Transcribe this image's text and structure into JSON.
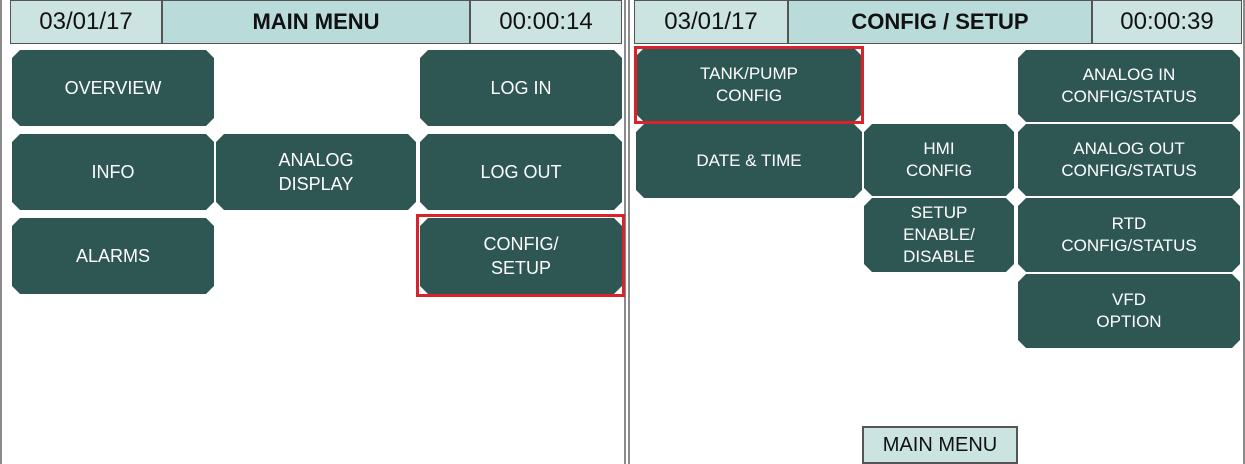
{
  "main_menu": {
    "date": "03/01/17",
    "title": "MAIN MENU",
    "time": "00:00:14",
    "buttons": {
      "overview": "OVERVIEW",
      "log_in": "LOG IN",
      "info": "INFO",
      "analog_display": "ANALOG\nDISPLAY",
      "log_out": "LOG OUT",
      "alarms": "ALARMS",
      "config_setup": "CONFIG/\nSETUP"
    }
  },
  "config_setup": {
    "date": "03/01/17",
    "title": "CONFIG / SETUP",
    "time": "00:00:39",
    "buttons": {
      "tank_pump_config": "TANK/PUMP\nCONFIG",
      "analog_in": "ANALOG IN\nCONFIG/STATUS",
      "date_time": "DATE & TIME",
      "hmi_config": "HMI\nCONFIG",
      "analog_out": "ANALOG OUT\nCONFIG/STATUS",
      "setup_enable": "SETUP\nENABLE/\nDISABLE",
      "rtd": "RTD\nCONFIG/STATUS",
      "vfd_option": "VFD\nOPTION",
      "main_menu": "MAIN MENU"
    }
  },
  "colors": {
    "button_bg": "#2e5753",
    "header_bg": "#cbe3e1",
    "selection": "#d9232b"
  }
}
